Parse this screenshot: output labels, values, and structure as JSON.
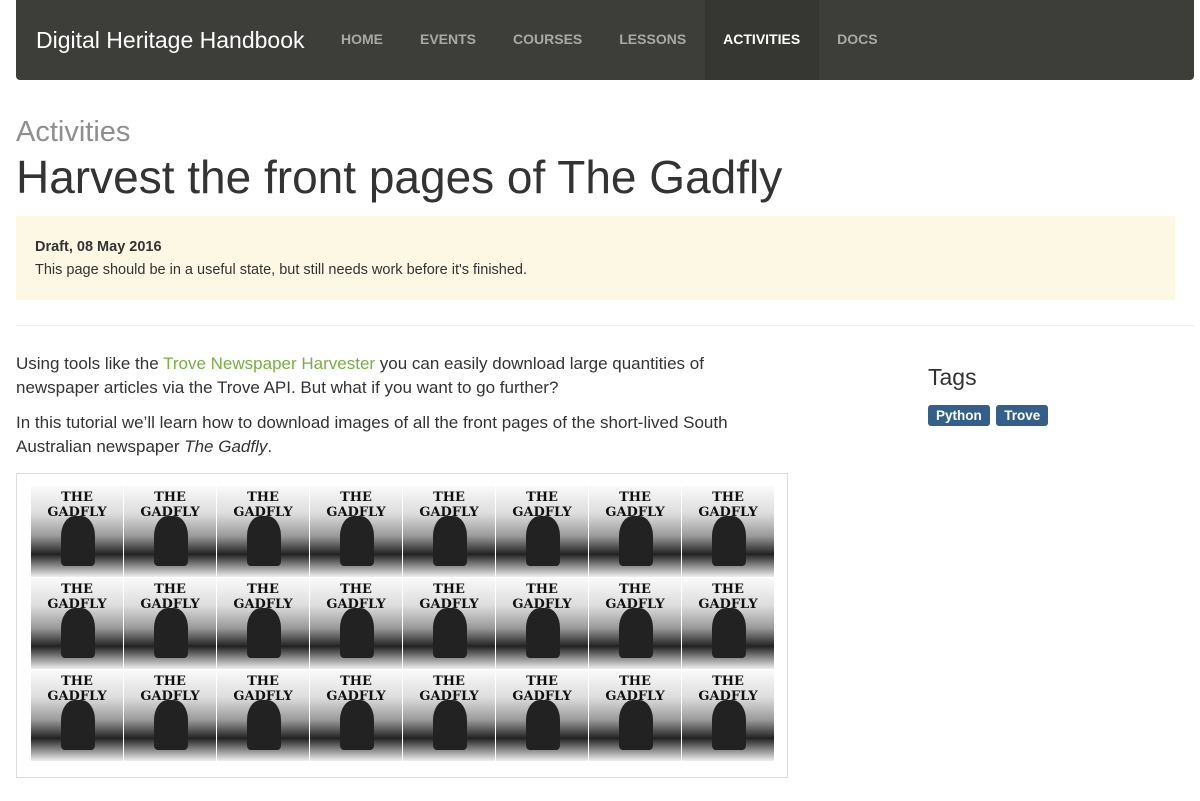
{
  "nav": {
    "brand": "Digital Heritage Handbook",
    "items": [
      {
        "label": "HOME"
      },
      {
        "label": "EVENTS"
      },
      {
        "label": "COURSES"
      },
      {
        "label": "LESSONS"
      },
      {
        "label": "ACTIVITIES",
        "active": true
      },
      {
        "label": "DOCS"
      }
    ]
  },
  "page": {
    "section": "Activities",
    "title": "Harvest the front pages of The Gadfly"
  },
  "notice": {
    "status": "Draft, 08 May 2016",
    "message": "This page should be in a useful state, but still needs work before it's finished."
  },
  "content": {
    "p1_before": "Using tools like the ",
    "p1_link": "Trove Newspaper Harvester",
    "p1_after": " you can easily download large quantities of newspaper articles via the Trove API. But what if you want to go further?",
    "p2_before": "In this tutorial we’ll learn how to download images of all the front pages of the short-lived South Australian newspaper ",
    "p2_em": "The Gadfly",
    "p2_after": "."
  },
  "tags": {
    "heading": "Tags",
    "items": [
      "Python",
      "Trove"
    ]
  },
  "figure": {
    "masthead": "THE GADFLY",
    "tile_count": 24
  }
}
